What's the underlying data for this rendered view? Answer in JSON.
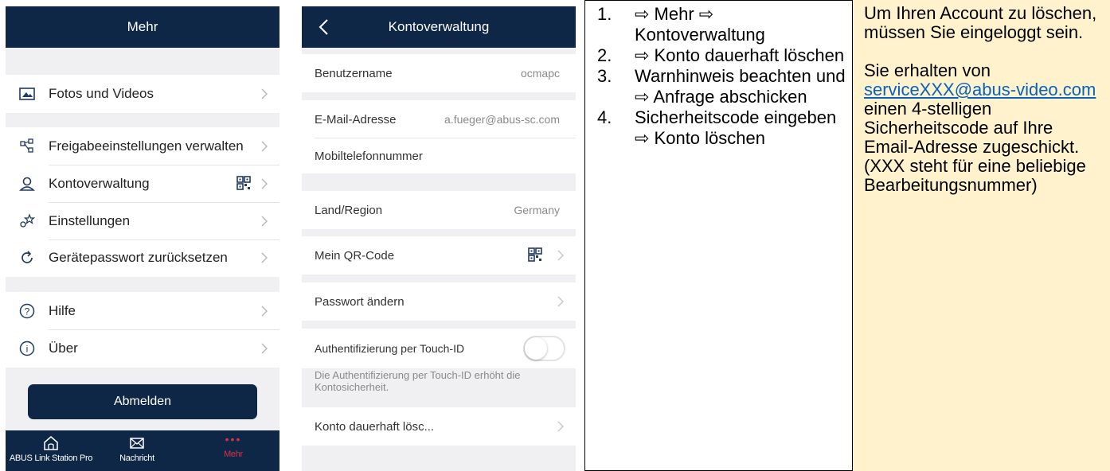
{
  "colors": {
    "navy": "#0f2747",
    "accent_red": "#d9304a",
    "info_bg": "#fff2cc",
    "link": "#0563c1"
  },
  "panel1": {
    "header_title": "Mehr",
    "items": [
      {
        "label": "Fotos und Videos",
        "icon": "photo-icon"
      },
      {
        "label": "Freigabeeinstellungen verwalten",
        "icon": "share-settings-icon"
      },
      {
        "label": "Kontoverwaltung",
        "icon": "user-icon"
      },
      {
        "label": "Einstellungen",
        "icon": "settings-icon"
      },
      {
        "label": "Gerätepasswort zurücksetzen",
        "icon": "reset-icon"
      },
      {
        "label": "Hilfe",
        "icon": "help-icon"
      },
      {
        "label": "Über",
        "icon": "info-icon"
      }
    ],
    "logout_label": "Abmelden",
    "tabs": [
      {
        "label": "ABUS Link Station Pro",
        "icon": "home-icon"
      },
      {
        "label": "Nachricht",
        "icon": "mail-icon"
      },
      {
        "label": "Mehr",
        "icon": "more-icon"
      }
    ]
  },
  "panel2": {
    "header_title": "Kontoverwaltung",
    "username_label": "Benutzername",
    "username_value": "ocmapc",
    "email_label": "E-Mail-Adresse",
    "email_value": "a.fueger@abus-sc.com",
    "phone_label": "Mobiltelefonnummer",
    "region_label": "Land/Region",
    "region_value": "Germany",
    "qr_label": "Mein QR-Code",
    "password_label": "Passwort ändern",
    "touch_id_label": "Authentifizierung per Touch-ID",
    "touch_id_enabled": false,
    "touch_id_note": "Die Authentifizierung per Touch-ID erhöht die Kontosicherheit.",
    "delete_label": "Konto dauerhaft lösc..."
  },
  "steps": [
    {
      "num": "1.",
      "text": "⇨ Mehr ⇨ Kontoverwaltung"
    },
    {
      "num": "2.",
      "text": "⇨ Konto dauerhaft löschen"
    },
    {
      "num": "3.",
      "text": "Warnhinweis beachten und ⇨ Anfrage abschicken"
    },
    {
      "num": "4.",
      "text": "Sicherheitscode eingeben ⇨ Konto löschen"
    }
  ],
  "info": {
    "para1": "Um Ihren Account zu löschen, müssen Sie eingeloggt sein.",
    "para2_pre": "Sie erhalten von",
    "email": "serviceXXX@abus-video.com",
    "para2_post": "einen 4-stelligen Sicherheitscode auf Ihre Email-Adresse zugeschickt.",
    "para3": "(XXX steht für eine beliebige Bearbeitungsnummer)"
  }
}
